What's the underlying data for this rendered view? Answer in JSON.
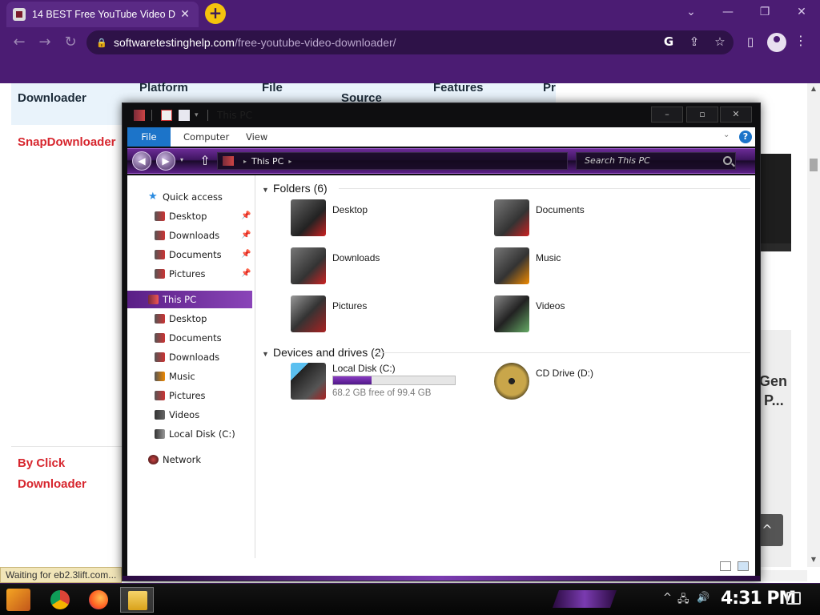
{
  "browser": {
    "tab_title": "14 BEST Free YouTube Video D",
    "tab_close": "✕",
    "new_tab": "+",
    "url_host": "softwaretestinghelp.com",
    "url_path": "/free-youtube-video-downloader/",
    "window_controls": {
      "minimize": "—",
      "restore": "❐",
      "close": "✕",
      "dropdown": "⌄"
    },
    "nav": {
      "back": "←",
      "forward": "→",
      "reload": "↻"
    }
  },
  "webpage": {
    "table_headers": [
      "Downloader",
      "Platform",
      "File",
      "Source",
      "Features",
      "Pr"
    ],
    "rows": [
      "SnapDownloader",
      "By Click",
      "Downloader"
    ],
    "promo_text": [
      "Gen",
      "P..."
    ],
    "scroll_top_button": "^",
    "status_text": "Waiting for eb2.3lift.com..."
  },
  "explorer": {
    "title": "This PC",
    "window_buttons": {
      "minimize": "–",
      "maximize": "▫",
      "close": "✕"
    },
    "ribbon_tabs": [
      "File",
      "Computer",
      "View"
    ],
    "help": "?",
    "breadcrumb": "This PC",
    "search_placeholder": "Search This PC",
    "nav_pane": {
      "quick_access": "Quick access",
      "quick_items": [
        "Desktop",
        "Downloads",
        "Documents",
        "Pictures"
      ],
      "this_pc": "This PC",
      "pc_items": [
        "Desktop",
        "Documents",
        "Downloads",
        "Music",
        "Pictures",
        "Videos",
        "Local Disk (C:)"
      ],
      "network": "Network"
    },
    "folders_header": "Folders (6)",
    "folders": [
      "Desktop",
      "Documents",
      "Downloads",
      "Music",
      "Pictures",
      "Videos"
    ],
    "devices_header": "Devices and drives (2)",
    "drives": {
      "c_label": "Local Disk (C:)",
      "c_free": "68.2 GB free of 99.4 GB",
      "c_used_fraction": 0.314,
      "d_label": "CD Drive (D:)"
    }
  },
  "taskbar": {
    "clock": "4:31 PM",
    "apps": [
      "start-button",
      "chrome-app",
      "firefox-app",
      "file-explorer-app"
    ]
  },
  "colors": {
    "browser_frame": "#4b1c73",
    "accent_purple": "#6b2b96",
    "file_tab_blue": "#1c74c9",
    "link_red": "#d7262e"
  }
}
